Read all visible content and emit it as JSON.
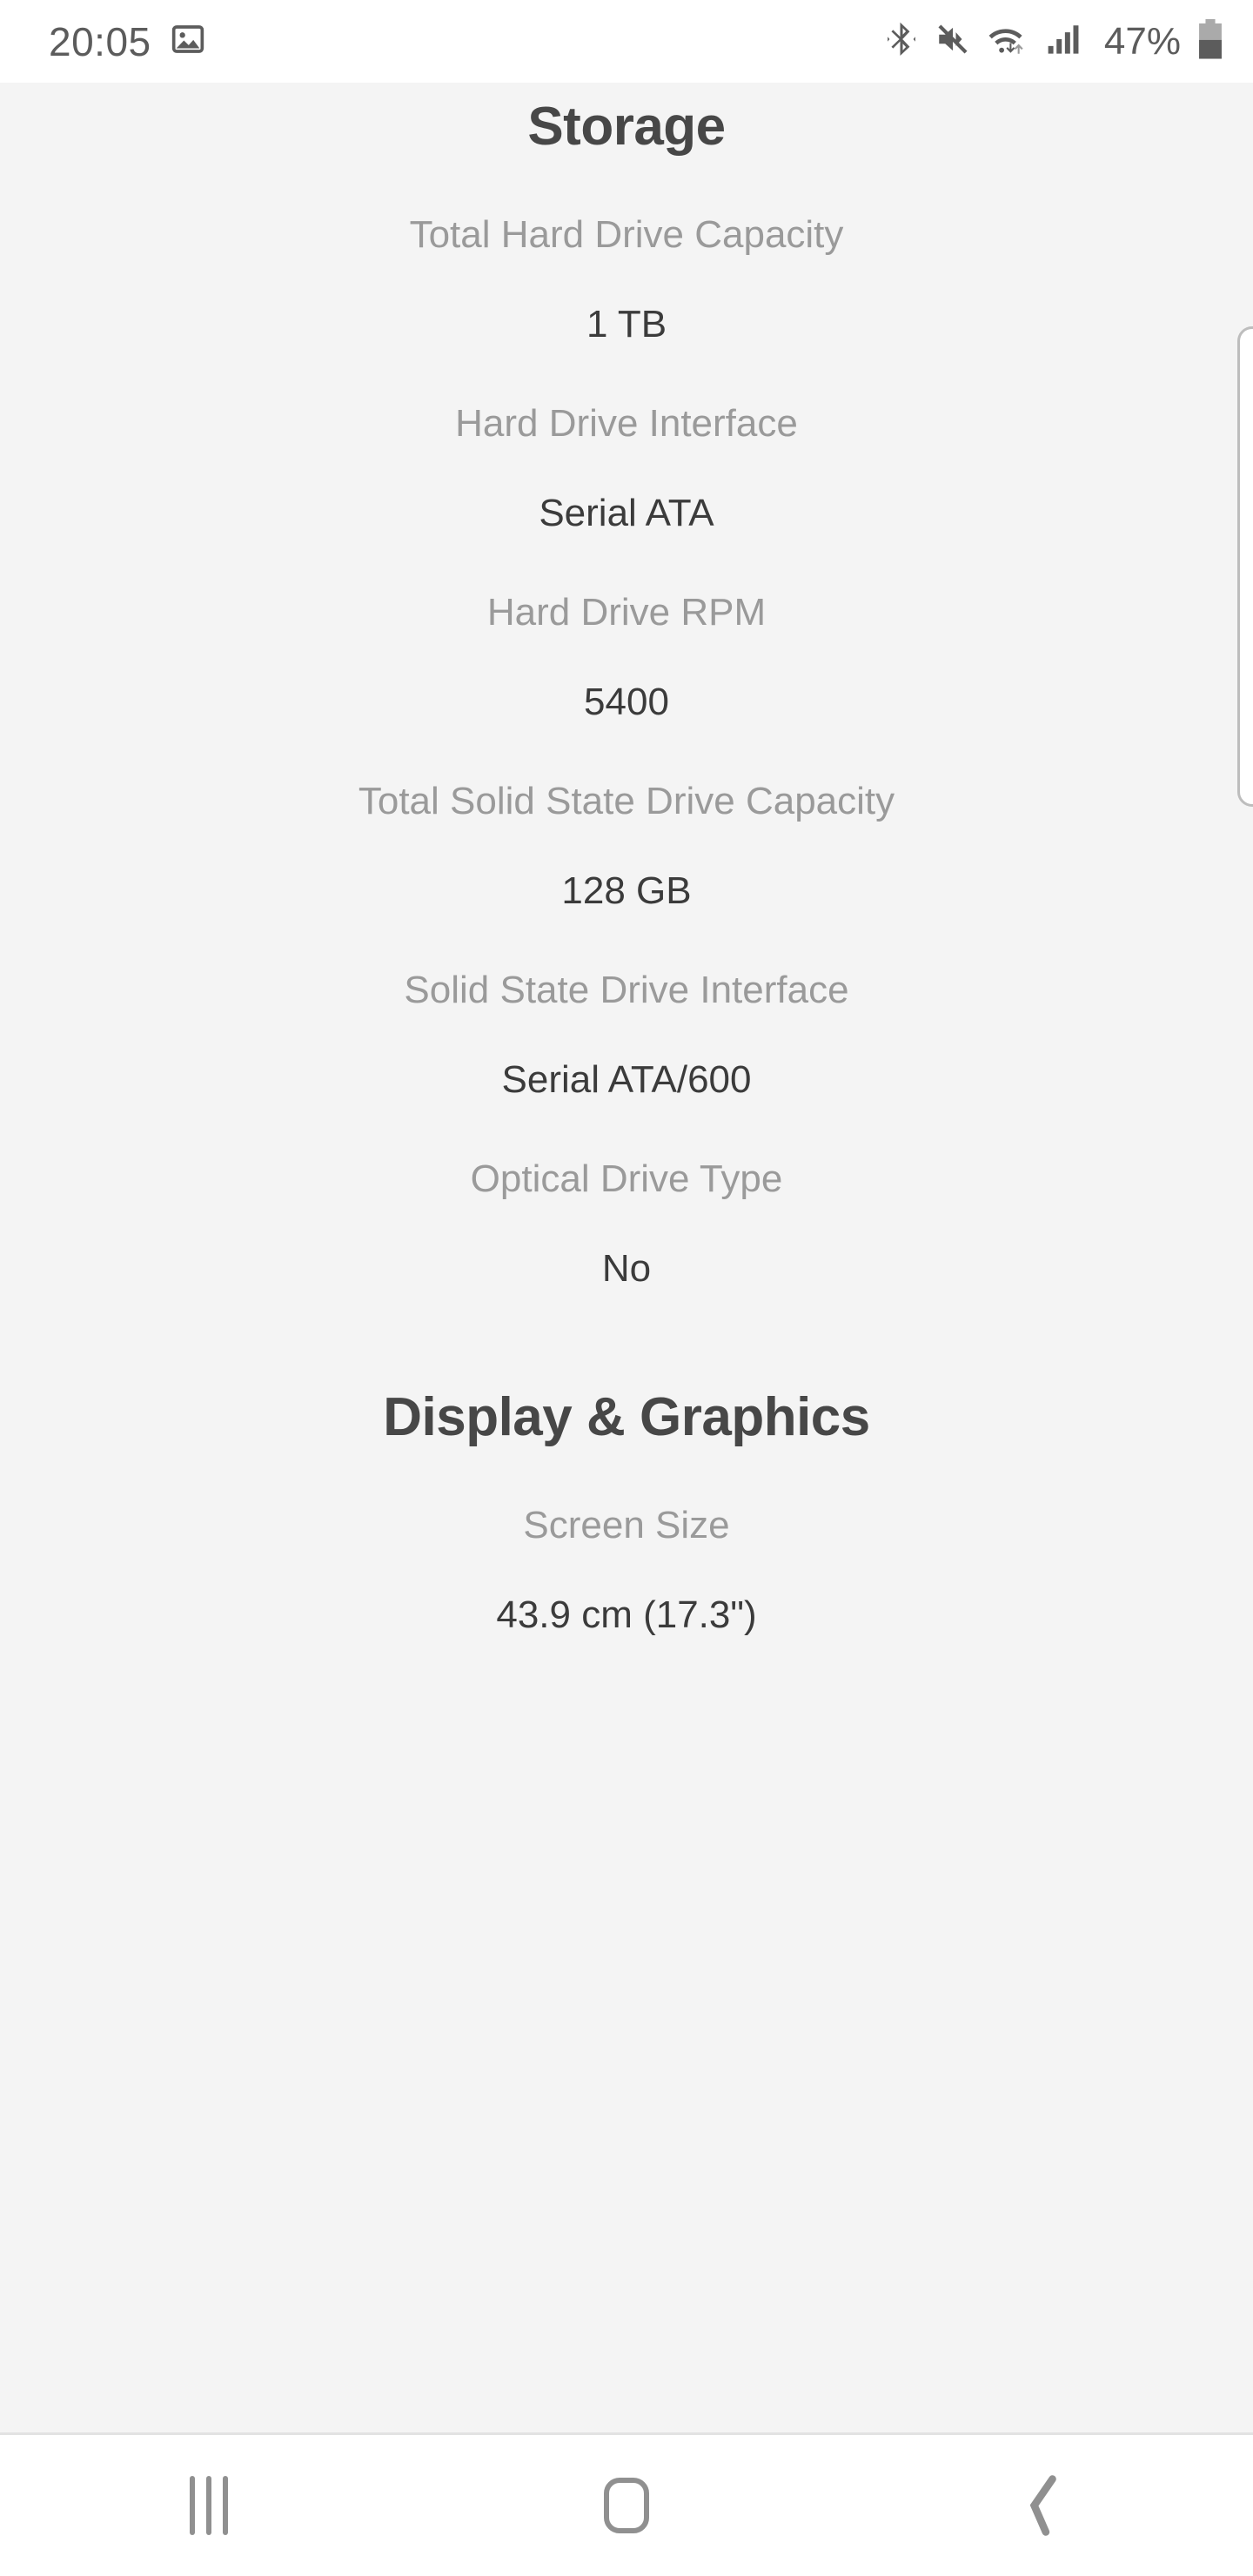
{
  "status_bar": {
    "time": "20:05",
    "battery_percent": "47%",
    "icons": [
      "screenshot-image-icon",
      "bluetooth-icon",
      "sound-muted-icon",
      "wifi-transfer-icon",
      "cellular-signal-icon",
      "battery-icon"
    ]
  },
  "sections": [
    {
      "title": "Storage",
      "specs": [
        {
          "label": "Total Hard Drive Capacity",
          "value": "1 TB"
        },
        {
          "label": "Hard Drive Interface",
          "value": "Serial ATA"
        },
        {
          "label": "Hard Drive RPM",
          "value": "5400"
        },
        {
          "label": "Total Solid State Drive Capacity",
          "value": "128 GB"
        },
        {
          "label": "Solid State Drive Interface",
          "value": "Serial ATA/600"
        },
        {
          "label": "Optical Drive Type",
          "value": "No"
        }
      ]
    },
    {
      "title": "Display & Graphics",
      "specs": [
        {
          "label": "Screen Size",
          "value": "43.9 cm (17.3\")"
        }
      ]
    }
  ],
  "nav_bar": {
    "recents_label": "Recents",
    "home_label": "Home",
    "back_label": "Back",
    "back_glyph": "‹"
  },
  "colors": {
    "page_background": "#f4f4f4",
    "bar_background": "#ffffff",
    "heading_text": "#474747",
    "label_text": "#9a9a9a",
    "value_text": "#3b3b3b",
    "status_icon": "#5c5c5c",
    "nav_icon": "#909090",
    "scrollbar": "#bdbdbd"
  }
}
